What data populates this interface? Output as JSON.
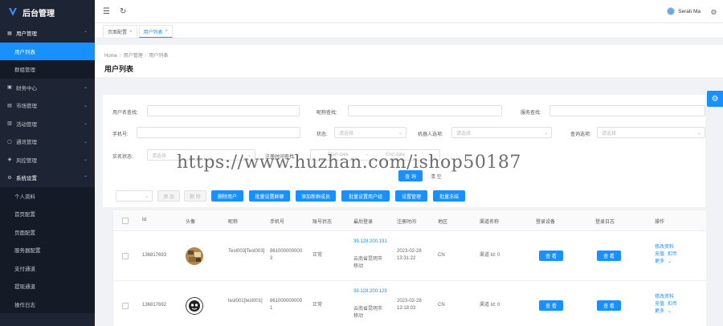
{
  "app": {
    "title": "后台管理"
  },
  "sidebar": {
    "items": [
      {
        "label": "用户管理",
        "icon": "grid-icon",
        "open": true,
        "children": [
          {
            "label": "用户列表",
            "active": true
          },
          {
            "label": "群组管理",
            "active": false
          }
        ]
      },
      {
        "label": "财务中心",
        "icon": "wallet-icon"
      },
      {
        "label": "市场管理",
        "icon": "shop-icon"
      },
      {
        "label": "活动管理",
        "icon": "gift-icon"
      },
      {
        "label": "通讯管理",
        "icon": "chat-icon"
      },
      {
        "label": "风控管理",
        "icon": "shield-icon"
      },
      {
        "label": "系统设置",
        "icon": "gear-icon",
        "open": true,
        "children": [
          {
            "label": "个人资料"
          },
          {
            "label": "首页配置"
          },
          {
            "label": "页面配置"
          },
          {
            "label": "服务器配置"
          },
          {
            "label": "支付通道"
          },
          {
            "label": "提现通道"
          },
          {
            "label": "操作日志"
          }
        ]
      }
    ]
  },
  "topbar": {
    "user_name": "Serati Ma"
  },
  "tabs": [
    {
      "label": "页面配置",
      "active": false
    },
    {
      "label": "用户列表",
      "active": true
    }
  ],
  "breadcrumb": {
    "home": "Home",
    "level1": "用户管理",
    "level2": "用户列表"
  },
  "page_title": "用户列表",
  "filters": {
    "username_label": "用户名查找:",
    "nickname_label": "昵称查找:",
    "account_label": "服务查找:",
    "phone_label": "手机号:",
    "status_label": "状态:",
    "status_placeholder": "请选择",
    "robot_label": "机器人选项:",
    "robot_placeholder": "请选择",
    "online_label": "查询选项:",
    "online_placeholder": "请选择",
    "realname_label": "实名状态:",
    "realname_placeholder": "请选择",
    "time_label": "注册时间查找:",
    "start_placeholder": "Start date",
    "end_placeholder": "End date",
    "search_label": "查 询",
    "clear_label": "清 空"
  },
  "actions": {
    "select_placeholder": "",
    "add": "添 加",
    "delete": "删 除",
    "btn1": "删除用户",
    "btn2": "批量设置群聊",
    "btn3": "添加新群成员",
    "btn4": "批量设置用户组",
    "btn5": "设置管理",
    "btn6": "批量冻结"
  },
  "table": {
    "headers": [
      "Id",
      "头像",
      "昵称",
      "手机号",
      "账号状态",
      "最后登录",
      "注册时间",
      "地区",
      "渠道名称",
      "登录设备",
      "登录日志",
      "操作"
    ],
    "rows": [
      {
        "id": "136817693",
        "nickname": "Test003[Test003]",
        "phone": "8610000000003",
        "status": "正常",
        "ip": "39.128.200.191",
        "ip_loc": "云南省昆明市 移动",
        "reg_date": "2023-02-28",
        "reg_time": "13:31:22",
        "region": "CN",
        "channel": "渠道 Id: 0",
        "device_btn": "查 看",
        "log_btn": "查 看",
        "op1": "修改资料",
        "op2": "充值",
        "op3": "扣币",
        "op4": "更多"
      },
      {
        "id": "136817692",
        "nickname": "test001[test001]",
        "phone": "8610000000001",
        "status": "正常",
        "ip": "39.128.200.129",
        "ip_loc": "云南省昆明市 移动",
        "reg_date": "2023-02-28",
        "reg_time": "13:18:03",
        "region": "CN",
        "channel": "渠道 Id: 0",
        "device_btn": "查 看",
        "log_btn": "查 看",
        "op1": "修改资料",
        "op2": "充值",
        "op3": "扣币",
        "op4": "更多"
      }
    ]
  },
  "watermark": "https://www.huzhan.com/ishop50187",
  "colors": {
    "primary": "#1890ff",
    "sidebar": "#1d2534",
    "sidebar_sub": "#141a26"
  }
}
